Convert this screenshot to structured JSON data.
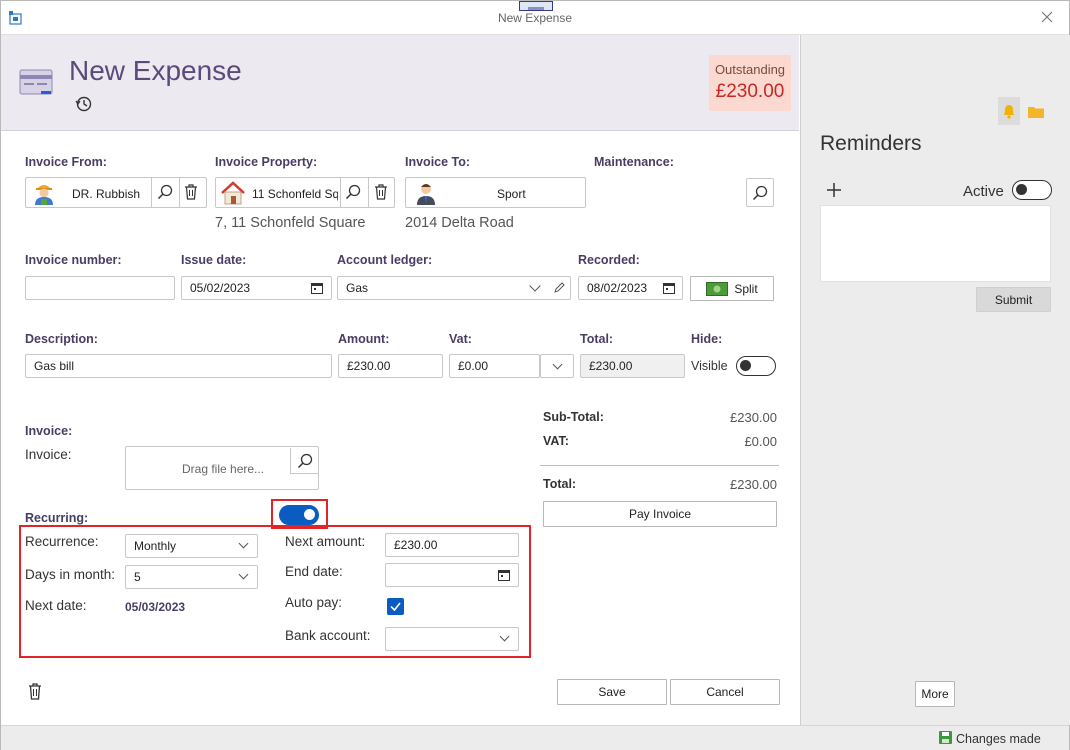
{
  "window": {
    "title": "New Expense"
  },
  "header": {
    "title": "New Expense",
    "outstanding_label": "Outstanding",
    "outstanding_value": "£230.00"
  },
  "invoice_from": {
    "label": "Invoice From:",
    "value": "DR. Rubbish"
  },
  "invoice_property": {
    "label": "Invoice Property:",
    "value": "11 Schonfeld Sq",
    "address": "7, 11 Schonfeld Square"
  },
  "invoice_to": {
    "label": "Invoice To:",
    "value": "Sport",
    "address": "2014 Delta Road"
  },
  "maintenance": {
    "label": "Maintenance:"
  },
  "invoice_number": {
    "label": "Invoice number:",
    "value": ""
  },
  "issue_date": {
    "label": "Issue date:",
    "value": "05/02/2023"
  },
  "account_ledger": {
    "label": "Account ledger:",
    "value": "Gas"
  },
  "recorded": {
    "label": "Recorded:",
    "value": "08/02/2023"
  },
  "split_button": "Split",
  "description": {
    "label": "Description:",
    "value": "Gas bill"
  },
  "amount": {
    "label": "Amount:",
    "value": "£230.00"
  },
  "vat": {
    "label": "Vat:",
    "value": "£0.00"
  },
  "total": {
    "label": "Total:",
    "value": "£230.00"
  },
  "hide": {
    "label": "Hide:",
    "toggle_label": "Visible"
  },
  "invoice_section": {
    "heading": "Invoice:",
    "label": "Invoice:",
    "drop_placeholder": "Drag file here..."
  },
  "summary": {
    "subtotal_label": "Sub-Total:",
    "subtotal_value": "£230.00",
    "vat_label": "VAT:",
    "vat_value": "£0.00",
    "total_label": "Total:",
    "total_value": "£230.00",
    "pay_button": "Pay Invoice"
  },
  "recurring": {
    "heading": "Recurring:",
    "recurrence_label": "Recurrence:",
    "recurrence_value": "Monthly",
    "days_label": "Days in month:",
    "days_value": "5",
    "next_date_label": "Next date:",
    "next_date_value": "05/03/2023",
    "next_amount_label": "Next amount:",
    "next_amount_value": "£230.00",
    "end_date_label": "End date:",
    "end_date_value": "",
    "auto_pay_label": "Auto pay:",
    "bank_account_label": "Bank account:",
    "bank_account_value": ""
  },
  "footer": {
    "save": "Save",
    "cancel": "Cancel"
  },
  "reminders": {
    "title": "Reminders",
    "active_label": "Active",
    "submit": "Submit",
    "more": "More"
  },
  "status": {
    "text": "Changes made"
  },
  "colors": {
    "accent": "#5b4a7a",
    "outstanding_bg": "#fbd9d0",
    "outstanding_text": "#c62828",
    "toggle_on": "#0a5cc2",
    "highlight": "#e0242a"
  }
}
